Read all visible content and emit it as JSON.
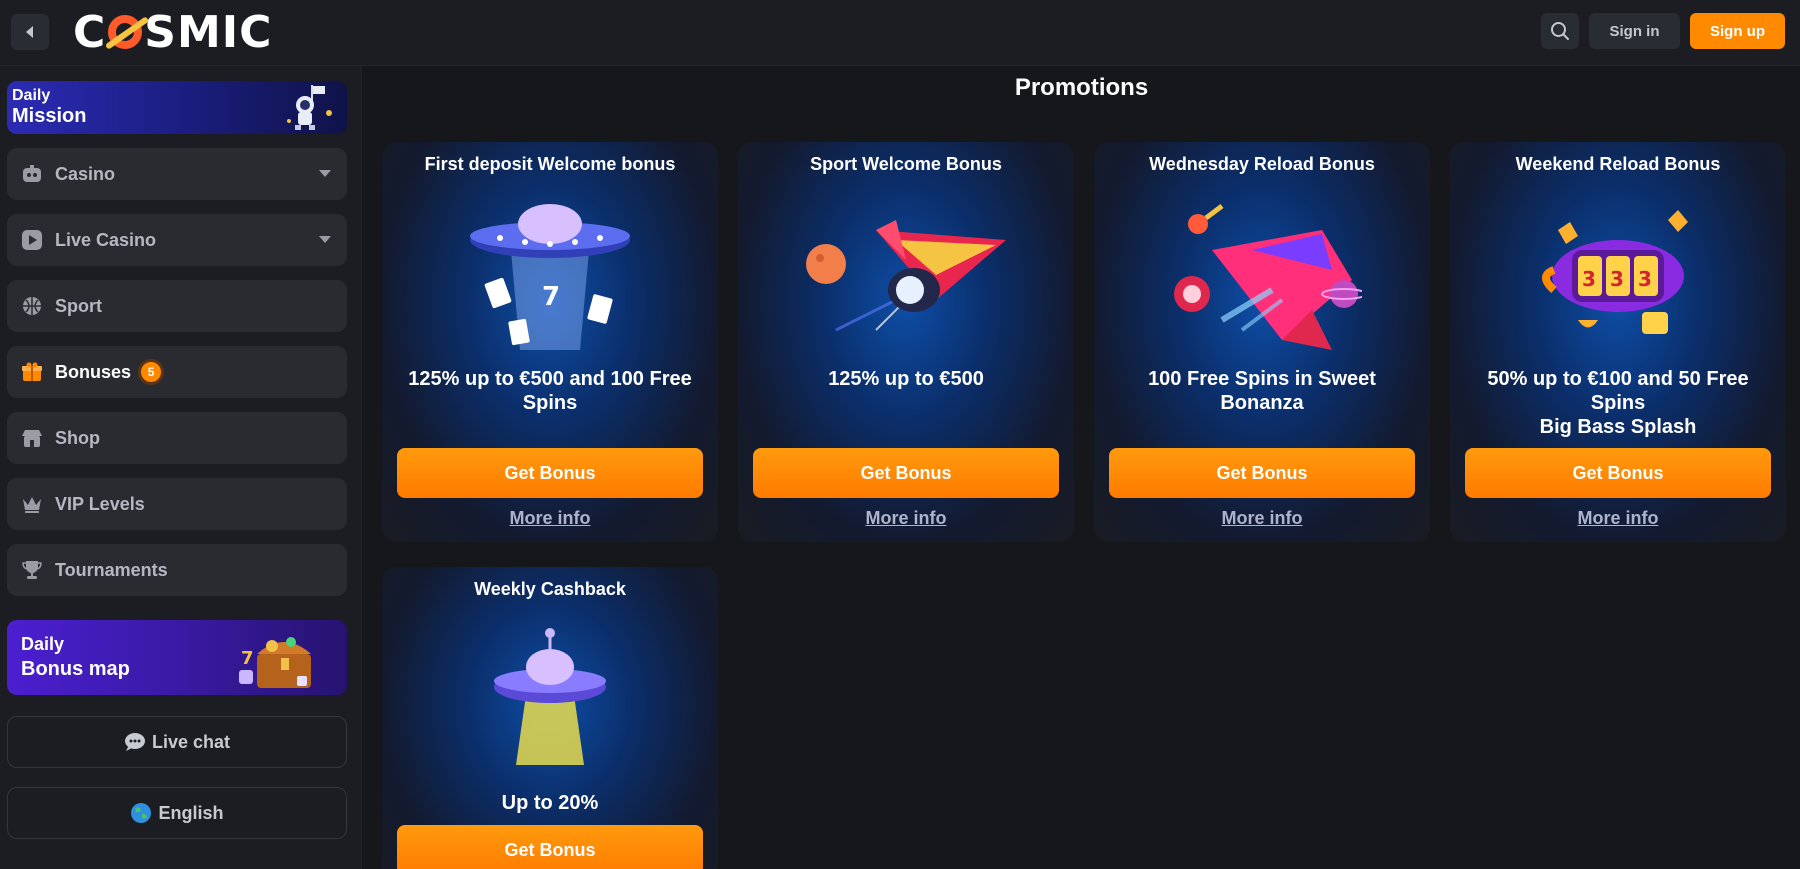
{
  "header": {
    "logo_text": "COSMIC",
    "signin_label": "Sign in",
    "signup_label": "Sign up"
  },
  "sidebar": {
    "mission_banner": {
      "line1": "Daily",
      "line2": "Mission"
    },
    "items": [
      {
        "label": "Casino",
        "icon": "casino-icon",
        "has_dropdown": true
      },
      {
        "label": "Live Casino",
        "icon": "live-casino-icon",
        "has_dropdown": true
      },
      {
        "label": "Sport",
        "icon": "sport-icon"
      },
      {
        "label": "Bonuses",
        "icon": "gift-icon",
        "badge": "5"
      },
      {
        "label": "Shop",
        "icon": "shop-icon"
      },
      {
        "label": "VIP Levels",
        "icon": "crown-icon"
      },
      {
        "label": "Tournaments",
        "icon": "trophy-icon"
      }
    ],
    "bonusmap_banner": {
      "line1": "Daily",
      "line2": "Bonus map"
    },
    "live_chat_label": "Live chat",
    "language_label": "English"
  },
  "main": {
    "title": "Promotions",
    "cards": [
      {
        "title": "First deposit Welcome bonus",
        "desc": "125% up to €500 and 100 Free Spins",
        "cta": "Get Bonus",
        "more": "More info"
      },
      {
        "title": "Sport Welcome Bonus",
        "desc": "125% up to €500",
        "cta": "Get Bonus",
        "more": "More info"
      },
      {
        "title": "Wednesday Reload Bonus",
        "desc": "100 Free Spins in Sweet Bonanza",
        "cta": "Get Bonus",
        "more": "More info"
      },
      {
        "title": "Weekend Reload Bonus",
        "desc": "50% up to €100 and 50 Free Spins\nBig Bass Splash",
        "desc_line1": "50% up to €100 and 50 Free Spins",
        "desc_line2": "Big Bass Splash",
        "cta": "Get Bonus",
        "more": "More info"
      },
      {
        "title": "Weekly Cashback",
        "desc": "Up to 20%",
        "cta": "Get Bonus"
      }
    ]
  },
  "colors": {
    "accent_orange": "#ff8a00",
    "background": "#16171b",
    "sidebar": "#1c1d22"
  }
}
